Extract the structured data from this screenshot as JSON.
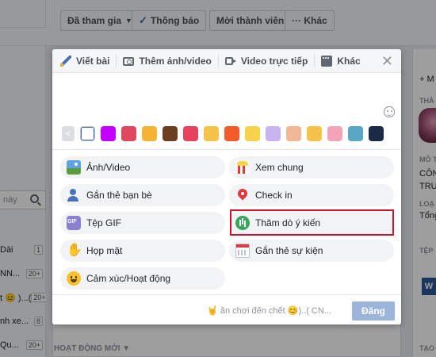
{
  "background": {
    "toolbar": {
      "joined_label": "Đã tham gia",
      "notify_label": "Thông báo",
      "invite_label": "Mời thành viên",
      "more_label": "··· Khác"
    },
    "search_placeholder": "này",
    "left_list": [
      {
        "text": "Dài",
        "count": "1"
      },
      {
        "text": "NN...",
        "count": "20+"
      },
      {
        "text": "t 😐 )...(",
        "count": "20+"
      },
      {
        "text": "nh xe...",
        "count": "8"
      },
      {
        "text": "Qu...",
        "count": "20+"
      }
    ],
    "activity_label": "HOẠT ĐỘNG MỚI",
    "right_texts": [
      "+ M",
      "THÀ",
      "MÔ T",
      "CÔN",
      "TRU",
      "LOẠ",
      "Tổng",
      "TỆP",
      "TẠO"
    ],
    "doc_letter": "W"
  },
  "composer": {
    "tabs": [
      {
        "label": "Viết bài",
        "icon": "pencil-icon"
      },
      {
        "label": "Thêm ảnh/video",
        "icon": "camera-icon"
      },
      {
        "label": "Video trực tiếp",
        "icon": "video-camera-icon"
      },
      {
        "label": "Khác",
        "icon": "more-icon"
      }
    ],
    "close_label": "✕",
    "swatch_colors": [
      "#ffffff",
      "#c600ff",
      "#e0485f",
      "#f5b434",
      "#6b3e1f",
      "#e8425c",
      "#f5c24a",
      "#f25b2a",
      "#f5d34a",
      "#c7b3ef",
      "#f0b896",
      "#f5c24a",
      "#f4a3b8",
      "#58a7c4",
      "#1c2a4a"
    ],
    "options_left": [
      {
        "label": "Ảnh/Video",
        "icon": "photo-icon"
      },
      {
        "label": "Gắn thẻ bạn bè",
        "icon": "tag-friends-icon"
      },
      {
        "label": "Tệp GIF",
        "icon": "gif-icon"
      },
      {
        "label": "Họp mặt",
        "icon": "wave-hand-icon"
      },
      {
        "label": "Cảm xúc/Hoạt động",
        "icon": "smiley-icon"
      }
    ],
    "options_right": [
      {
        "label": "Xem chung",
        "icon": "popcorn-icon"
      },
      {
        "label": "Check in",
        "icon": "location-pin-icon"
      },
      {
        "label": "Thăm dò ý kiến",
        "icon": "poll-icon"
      },
      {
        "label": "Gắn thẻ sự kiện",
        "icon": "calendar-icon"
      }
    ],
    "footer_status": "🤘 ăn chơi đến chết 😊)..( CN...",
    "post_label": "Đăng"
  }
}
